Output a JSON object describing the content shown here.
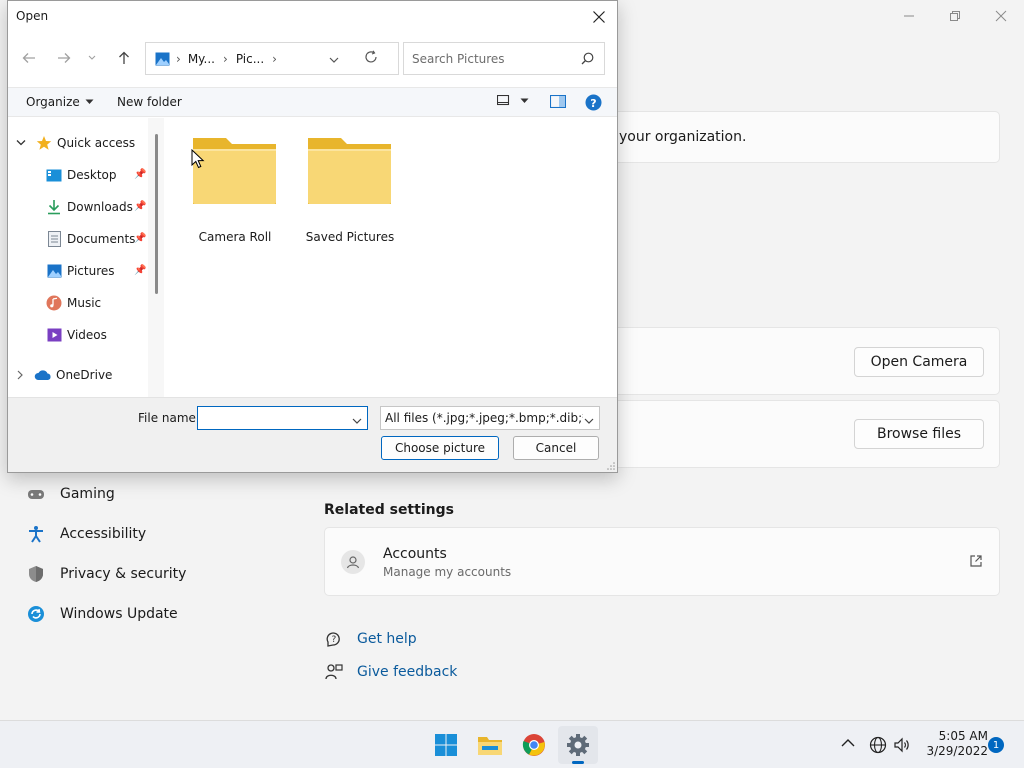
{
  "settings": {
    "org_text": "your organization.",
    "open_camera_label": "Open Camera",
    "browse_files_label": "Browse files",
    "related_settings_heading": "Related settings",
    "accounts_title": "Accounts",
    "accounts_subtitle": "Manage my accounts",
    "nav_items": [
      {
        "label": "Gaming",
        "icon": "gamepad-icon"
      },
      {
        "label": "Accessibility",
        "icon": "accessibility-icon"
      },
      {
        "label": "Privacy & security",
        "icon": "shield-icon"
      },
      {
        "label": "Windows Update",
        "icon": "update-icon"
      }
    ],
    "get_help_label": "Get help",
    "give_feedback_label": "Give feedback"
  },
  "dialog": {
    "title": "Open",
    "breadcrumb": [
      "My...",
      "Pic..."
    ],
    "search_placeholder": "Search Pictures",
    "organize_label": "Organize",
    "new_folder_label": "New folder",
    "nav_tree": [
      {
        "label": "Quick access",
        "icon": "star-icon",
        "pinned": false
      },
      {
        "label": "Desktop",
        "icon": "desktop-icon",
        "pinned": true
      },
      {
        "label": "Downloads",
        "icon": "download-icon",
        "pinned": true
      },
      {
        "label": "Documents",
        "icon": "document-icon",
        "pinned": true
      },
      {
        "label": "Pictures",
        "icon": "pictures-icon",
        "pinned": true
      },
      {
        "label": "Music",
        "icon": "music-icon",
        "pinned": false
      },
      {
        "label": "Videos",
        "icon": "video-icon",
        "pinned": false
      },
      {
        "label": "OneDrive",
        "icon": "cloud-icon",
        "pinned": false
      }
    ],
    "folders": [
      {
        "label": "Camera Roll"
      },
      {
        "label": "Saved Pictures"
      }
    ],
    "file_name_label": "File name:",
    "file_name_value": "",
    "file_type_value": "All files (*.jpg;*.jpeg;*.bmp;*.dib;*.png",
    "choose_label": "Choose picture",
    "cancel_label": "Cancel"
  },
  "taskbar": {
    "time": "5:05 AM",
    "date": "3/29/2022",
    "notification_count": "1",
    "apps": [
      "windows-start-icon",
      "file-explorer-icon",
      "chrome-icon",
      "settings-gear-icon"
    ]
  },
  "colors": {
    "accent": "#0067c0",
    "folder_yellow": "#f8d775",
    "folder_dark": "#e8b52c"
  }
}
